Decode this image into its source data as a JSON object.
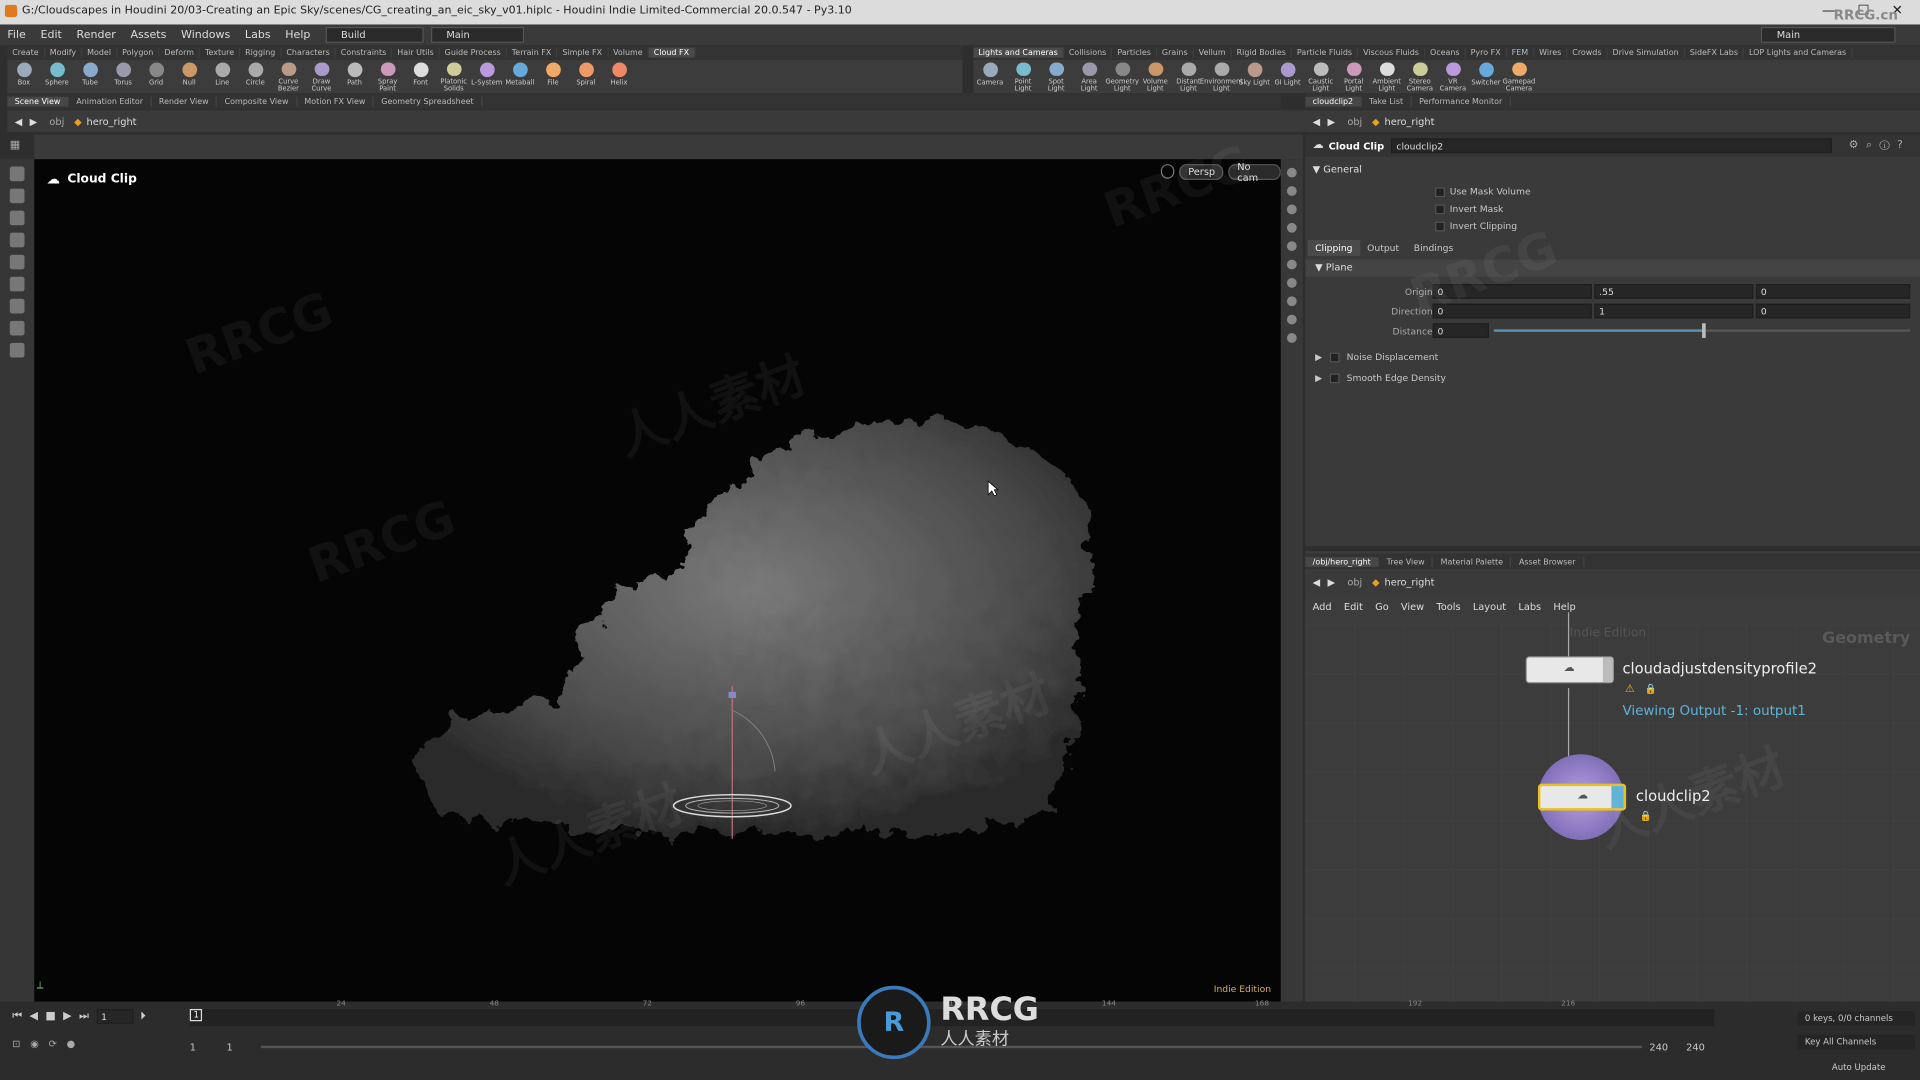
{
  "window": {
    "title": "G:/Cloudscapes in Houdini 20/03-Creating an Epic Sky/scenes/CG_creating_an_eic_sky_v01.hiplc - Houdini Indie Limited-Commercial 20.0.547 - Py3.10"
  },
  "menubar": {
    "items": [
      "File",
      "Edit",
      "Render",
      "Assets",
      "Windows",
      "Labs",
      "Help"
    ],
    "desktop_dropdown": "Build",
    "main_dropdown": "Main",
    "right_main": "Main"
  },
  "shelf_left": {
    "tabs": [
      "Create",
      "Modify",
      "Model",
      "Polygon",
      "Deform",
      "Texture",
      "Rigging",
      "Characters",
      "Constraints",
      "Hair Utils",
      "Guide Process",
      "Terrain FX",
      "Simple FX",
      "Volume",
      "Cloud FX"
    ],
    "tools": [
      "Box",
      "Sphere",
      "Tube",
      "Torus",
      "Grid",
      "Null",
      "Line",
      "Circle",
      "Curve Bezier",
      "Draw Curve",
      "Path",
      "Spray Paint",
      "Font",
      "Platonic Solids",
      "L-System",
      "Metaball",
      "File",
      "Spiral",
      "Helix"
    ]
  },
  "shelf_right": {
    "tabs": [
      "Lights and Cameras",
      "Collisions",
      "Particles",
      "Grains",
      "Vellum",
      "Rigid Bodies",
      "Particle Fluids",
      "Viscous Fluids",
      "Oceans",
      "Pyro FX",
      "FEM",
      "Wires",
      "Crowds",
      "Drive Simulation",
      "SideFX Labs",
      "LOP Lights and Cameras"
    ],
    "tools": [
      "Camera",
      "Point Light",
      "Spot Light",
      "Area Light",
      "Geometry Light",
      "Volume Light",
      "Distant Light",
      "Environment Light",
      "Sky Light",
      "GI Light",
      "Caustic Light",
      "Portal Light",
      "Ambient Light",
      "Stereo Camera",
      "VR Camera",
      "Switcher",
      "Gamepad Camera"
    ]
  },
  "pane_tabs_left": [
    "Scene View",
    "Animation Editor",
    "Render View",
    "Composite View",
    "Motion FX View",
    "Geometry Spreadsheet"
  ],
  "pane_tabs_right": [
    "cloudclip2",
    "Take List",
    "Performance Monitor"
  ],
  "path": {
    "context": "obj",
    "node": "hero_right"
  },
  "viewport": {
    "title": "Cloud Clip",
    "persp": "Persp",
    "cam": "No cam",
    "edition": "Indie Edition"
  },
  "parm": {
    "type": "Cloud Clip",
    "name": "cloudclip2",
    "section_general": "General",
    "use_mask_volume": "Use Mask Volume",
    "invert_mask": "Invert Mask",
    "invert_clipping": "Invert Clipping",
    "tabs": [
      "Clipping",
      "Output",
      "Bindings"
    ],
    "plane": "Plane",
    "origin_label": "Origin",
    "origin": [
      "0",
      ".55",
      "0"
    ],
    "direction_label": "Direction",
    "direction": [
      "0",
      "1",
      "0"
    ],
    "distance_label": "Distance",
    "distance": "0",
    "distance_slider_fraction": 0.5,
    "noise": "Noise Displacement",
    "smooth": "Smooth Edge Density"
  },
  "network": {
    "tabs": [
      "/obj/hero_right",
      "Tree View",
      "Material Palette",
      "Asset Browser"
    ],
    "menu": [
      "Add",
      "Edit",
      "Go",
      "View",
      "Tools",
      "Layout",
      "Labs",
      "Help"
    ],
    "watermark_edition": "Indie Edition",
    "context_label": "Geometry",
    "node1": "cloudadjustdensityprofile2",
    "node1_status": "Viewing Output -1: output1",
    "node2": "cloudclip2"
  },
  "timeline": {
    "current_frame": "1",
    "frame_marker": "1",
    "ticks": [
      "24",
      "48",
      "72",
      "96",
      "120",
      "144",
      "168",
      "192",
      "216"
    ],
    "start": "1",
    "start2": "1",
    "end": "240",
    "end2": "240",
    "keys": "0 keys, 0/0 channels",
    "key_all": "Key All Channels",
    "auto_update": "Auto Update"
  },
  "watermark": {
    "main": "RRCG",
    "sub": "人人素材",
    "corner": "RRCG.cn"
  },
  "colors": {
    "node_selected": "#6fa8dc",
    "status_text": "#5fb3d6",
    "accent": "#e8a020"
  }
}
